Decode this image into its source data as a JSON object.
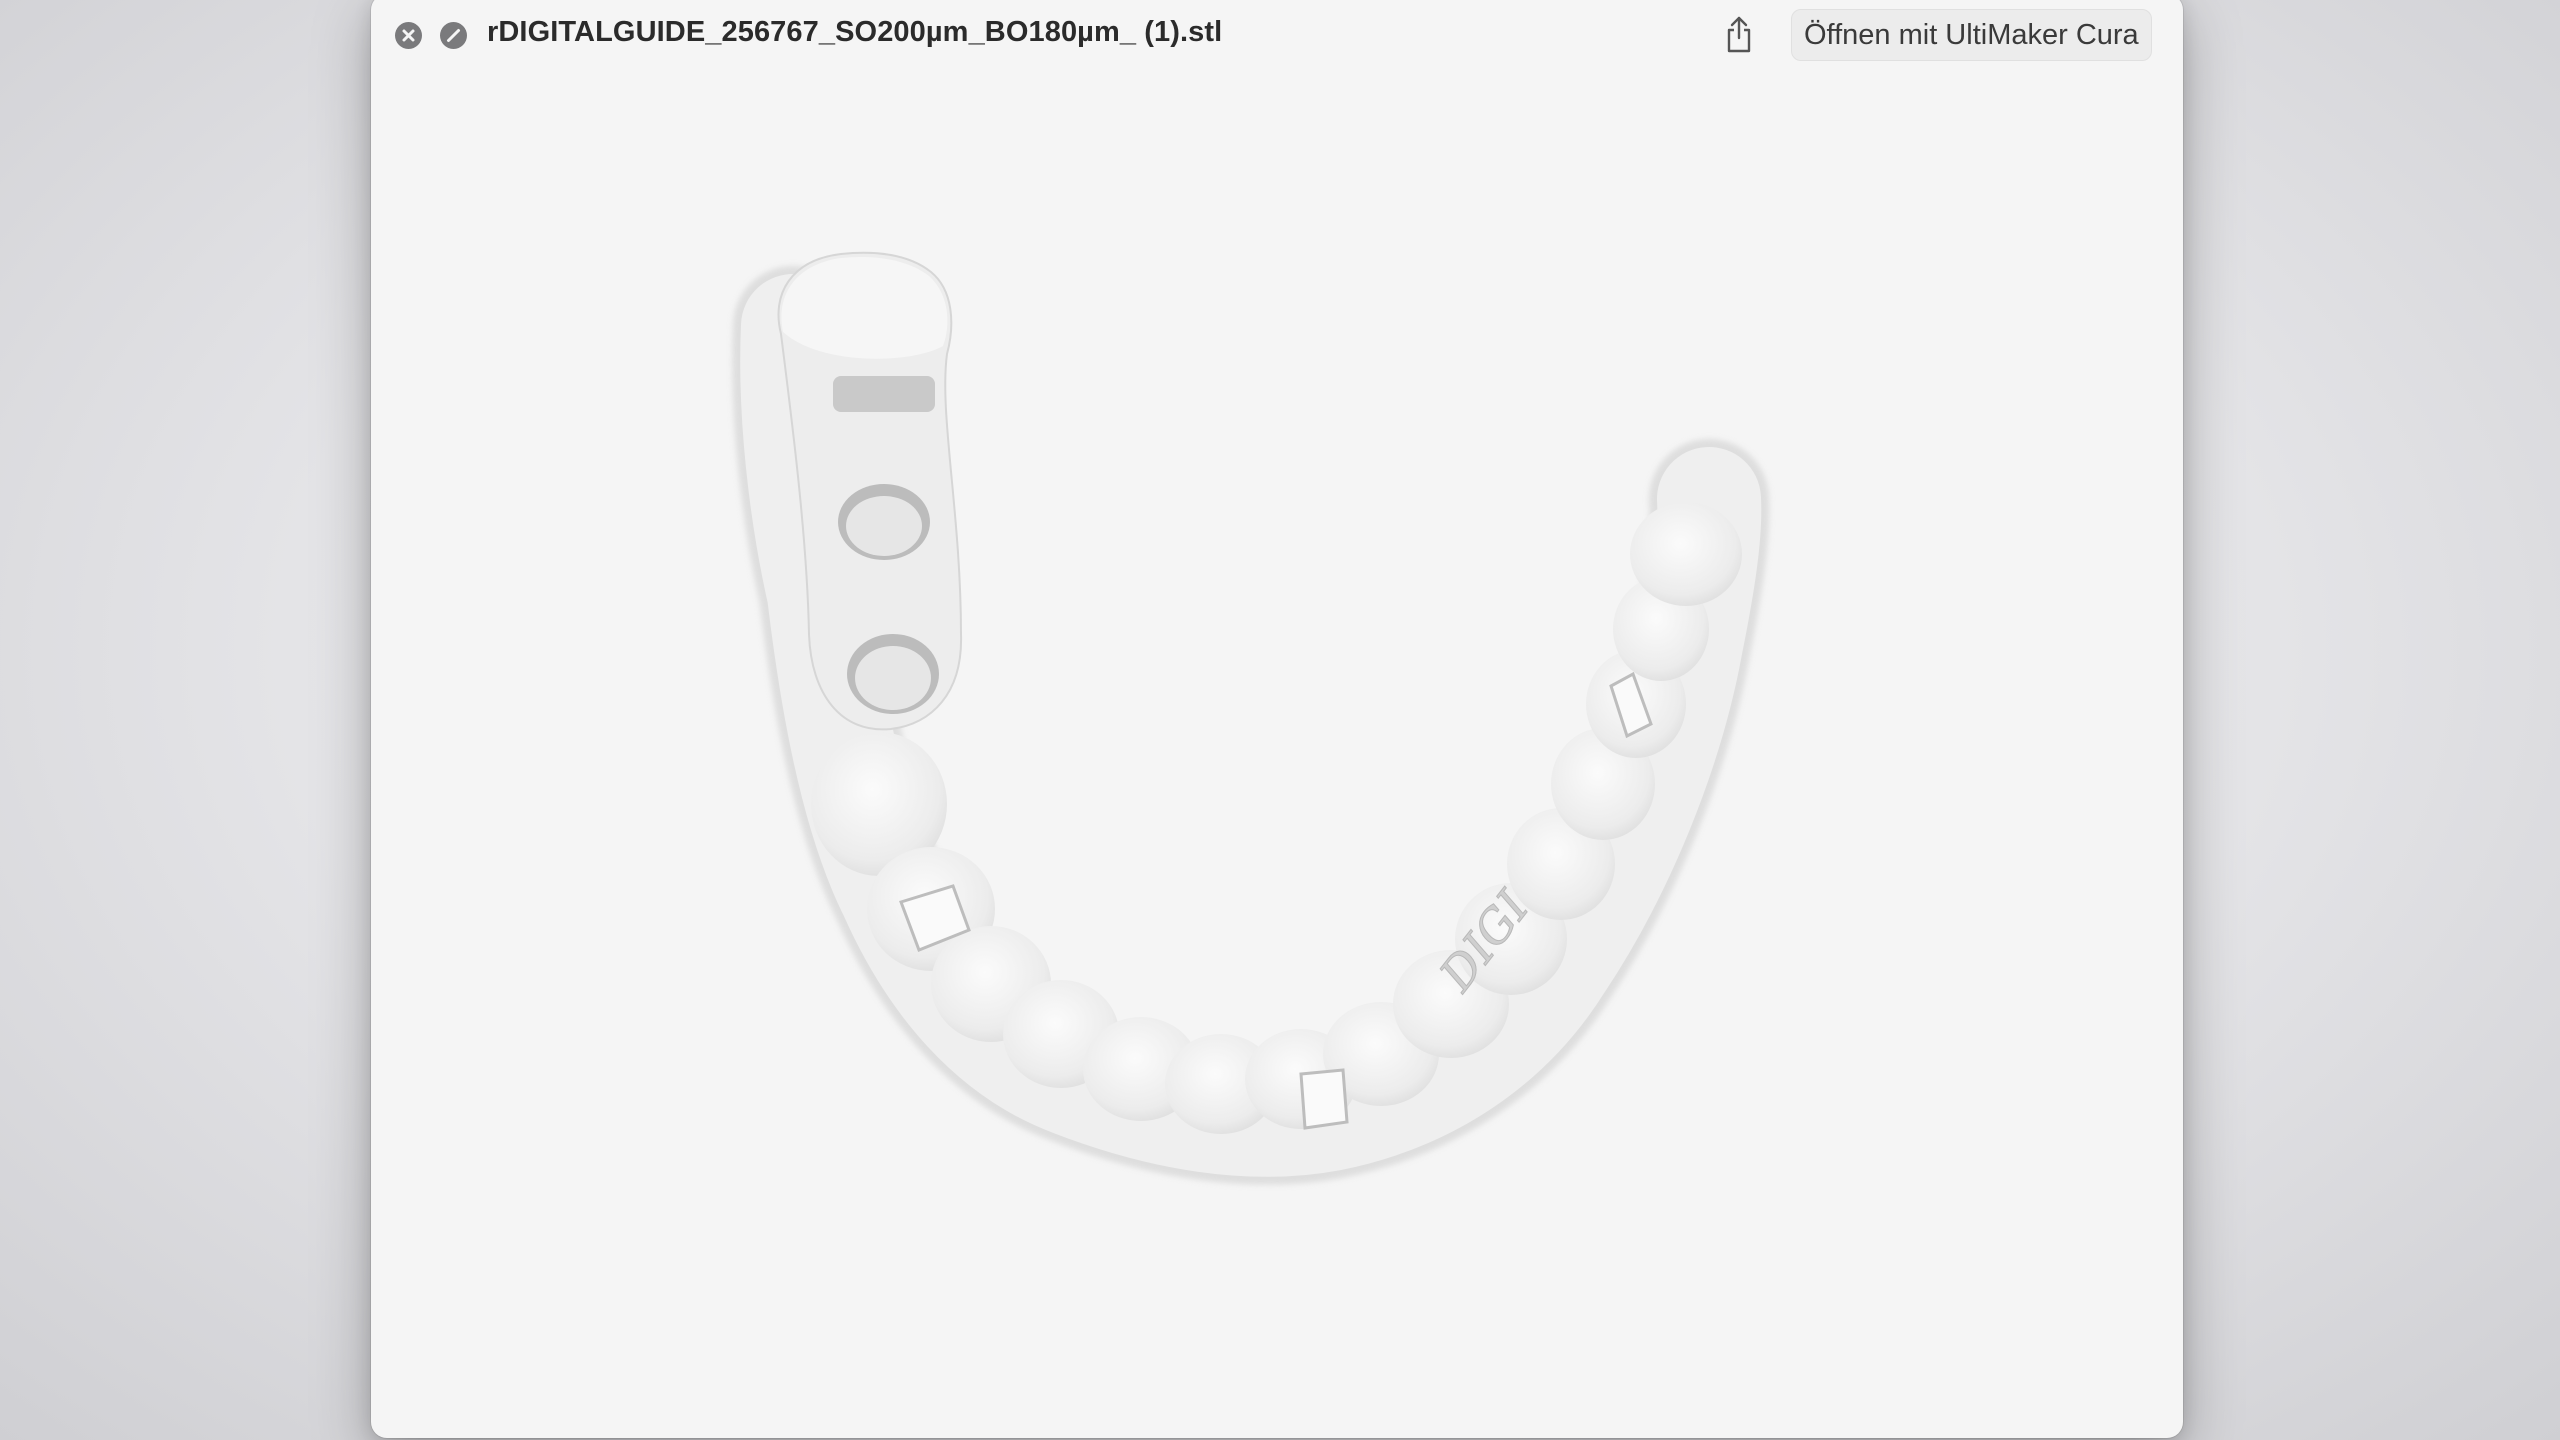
{
  "window": {
    "title": "rDIGITALGUIDE_256767_SO200µm_BO180µm_ (1).stl",
    "open_with_label": "Öffnen mit UltiMaker Cura"
  },
  "icons": {
    "close": "close-circle-icon",
    "fullscreen": "fullscreen-circle-icon",
    "share": "share-icon"
  },
  "model": {
    "engraving": "DIGI"
  },
  "colors": {
    "window_bg": "#f5f5f5",
    "model_fill": "#f1f1f1",
    "model_shadow": "#c9c9c9",
    "button_grey": "#7a7a7c"
  }
}
